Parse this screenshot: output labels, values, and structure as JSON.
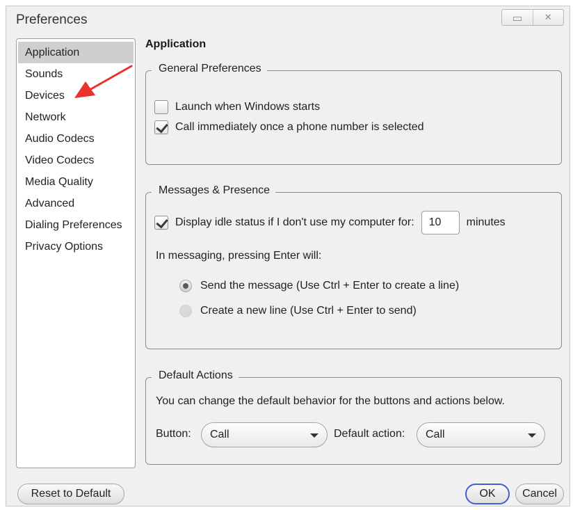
{
  "window": {
    "title": "Preferences",
    "minimize_icon": "minimize-icon",
    "close_icon": "close-icon",
    "close_glyph": "✕"
  },
  "sidebar": {
    "items": [
      {
        "label": "Application",
        "selected": true
      },
      {
        "label": "Sounds",
        "selected": false
      },
      {
        "label": "Devices",
        "selected": false
      },
      {
        "label": "Network",
        "selected": false
      },
      {
        "label": "Audio Codecs",
        "selected": false
      },
      {
        "label": "Video Codecs",
        "selected": false
      },
      {
        "label": "Media Quality",
        "selected": false
      },
      {
        "label": "Advanced",
        "selected": false
      },
      {
        "label": "Dialing Preferences",
        "selected": false
      },
      {
        "label": "Privacy Options",
        "selected": false
      }
    ]
  },
  "annotation": {
    "icon": "red-arrow-icon",
    "color": "#e8322b"
  },
  "main": {
    "section_title": "Application",
    "general": {
      "legend": "General Preferences",
      "launch_label": "Launch when Windows starts",
      "launch_checked": false,
      "call_label": "Call immediately once a phone number is selected",
      "call_checked": true
    },
    "messages": {
      "legend": "Messages & Presence",
      "idle_label": "Display idle status if I don't use my computer for:",
      "idle_checked": true,
      "idle_value": "10",
      "idle_unit": "minutes",
      "enter_prompt": "In messaging, pressing Enter will:",
      "radio_send": "Send the message (Use Ctrl + Enter to create a line)",
      "radio_newline": "Create a new line (Use Ctrl + Enter to send)",
      "selected": "send"
    },
    "default_actions": {
      "legend": "Default Actions",
      "description": "You can change the default behavior for the buttons and actions below.",
      "button_label": "Button:",
      "button_value": "Call",
      "action_label": "Default action:",
      "action_value": "Call"
    }
  },
  "footer": {
    "reset_label": "Reset to Default",
    "ok_label": "OK",
    "cancel_label": "Cancel"
  }
}
